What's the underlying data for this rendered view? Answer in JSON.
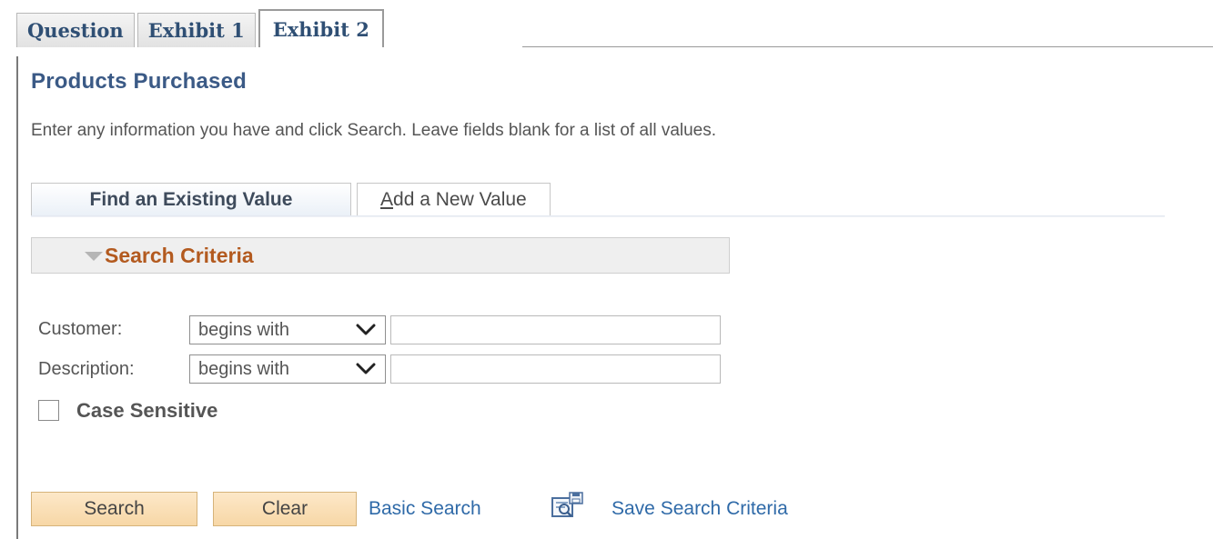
{
  "exhibit_tabs": [
    {
      "label": "Question",
      "active": false
    },
    {
      "label": "Exhibit 1",
      "active": false
    },
    {
      "label": "Exhibit 2",
      "active": true
    }
  ],
  "page": {
    "title": "Products Purchased",
    "instructions": "Enter any information you have and click Search. Leave fields blank for a list of all values."
  },
  "mode_tabs": {
    "find_label": "Find an Existing Value",
    "add_label_first": "A",
    "add_label_rest": "dd a New Value"
  },
  "criteria": {
    "header": "Search Criteria",
    "fields": [
      {
        "label": "Customer:",
        "operator": "begins with",
        "value": ""
      },
      {
        "label": "Description:",
        "operator": "begins with",
        "value": ""
      }
    ],
    "case_sensitive_label": "Case Sensitive",
    "case_sensitive_checked": false
  },
  "actions": {
    "search": "Search",
    "clear": "Clear",
    "basic_search": "Basic Search",
    "save_criteria": "Save Search Criteria"
  },
  "colors": {
    "tab_text": "#2f4f74",
    "title": "#3b5a86",
    "criteria_header": "#b35a1f",
    "link": "#2f6aa8",
    "button_fill": "#fbe0b6"
  },
  "icons": {
    "criteria_toggle": "triangle-down-icon",
    "operator_dropdown": "chevron-down-icon",
    "save_criteria": "save-search-icon"
  }
}
